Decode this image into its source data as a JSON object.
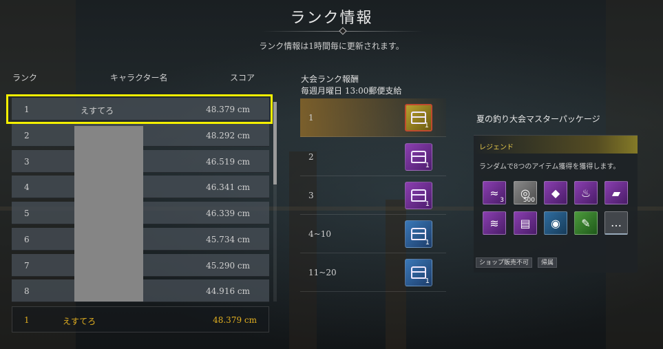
{
  "header": {
    "title": "ランク情報",
    "subtitle": "ランク情報は1時間毎に更新されます。"
  },
  "ranking": {
    "columns": {
      "rank": "ランク",
      "name": "キャラクター名",
      "score": "スコア"
    },
    "rows": [
      {
        "rank": "1",
        "name": "えすてろ",
        "score": "48.379 cm"
      },
      {
        "rank": "2",
        "name": "",
        "score": "48.292 cm"
      },
      {
        "rank": "3",
        "name": "",
        "score": "46.519 cm"
      },
      {
        "rank": "4",
        "name": "",
        "score": "46.341 cm"
      },
      {
        "rank": "5",
        "name": "",
        "score": "46.339 cm"
      },
      {
        "rank": "6",
        "name": "",
        "score": "45.734 cm"
      },
      {
        "rank": "7",
        "name": "",
        "score": "45.290 cm"
      },
      {
        "rank": "8",
        "name": "",
        "score": "44.916 cm"
      }
    ],
    "my_rank": {
      "rank": "1",
      "name": "えすてろ",
      "score": "48.379 cm"
    }
  },
  "rewards": {
    "title": "大会ランク報酬",
    "schedule": "毎週月曜日 13:00郵便支給",
    "tiers": [
      {
        "label": "1",
        "chest_color": "gold",
        "qty": "1"
      },
      {
        "label": "2",
        "chest_color": "purple",
        "qty": "1"
      },
      {
        "label": "3",
        "chest_color": "purple",
        "qty": "1"
      },
      {
        "label": "4~10",
        "chest_color": "blue",
        "qty": "1"
      },
      {
        "label": "11~20",
        "chest_color": "blue",
        "qty": "1"
      }
    ]
  },
  "package": {
    "name": "夏の釣り大会マスターパッケージ",
    "grade": "レジェンド",
    "description": "ランダムで8つのアイテム獲得を獲得します。",
    "items": [
      {
        "icon": "wave-icon",
        "color": "purple",
        "qty": "3"
      },
      {
        "icon": "coin-icon",
        "color": "grey",
        "qty": "500"
      },
      {
        "icon": "crystal-icon",
        "color": "purple",
        "qty": ""
      },
      {
        "icon": "flame-icon",
        "color": "purple",
        "qty": ""
      },
      {
        "icon": "book-icon",
        "color": "purple",
        "qty": ""
      },
      {
        "icon": "scroll-pile-icon",
        "color": "purple",
        "qty": ""
      },
      {
        "icon": "scroll-icon",
        "color": "purple",
        "qty": ""
      },
      {
        "icon": "shell-icon",
        "color": "blue",
        "qty": ""
      },
      {
        "icon": "ticket-icon",
        "color": "green",
        "qty": ""
      },
      {
        "icon": "more-icon",
        "color": "more",
        "qty": ""
      }
    ],
    "more_symbol": "…",
    "tags": [
      "ショップ販売不可",
      "帰属"
    ]
  }
}
